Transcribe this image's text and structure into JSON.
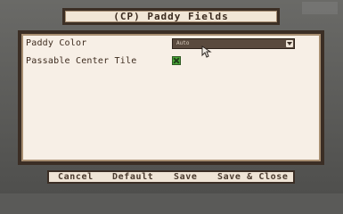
{
  "dialog": {
    "title": "(CP) Paddy Fields"
  },
  "options": [
    {
      "label": "Paddy Color",
      "control": "dropdown",
      "value": "Auto"
    },
    {
      "label": "Passable Center Tile",
      "control": "checkbox",
      "checked": true
    }
  ],
  "buttons": {
    "cancel": "Cancel",
    "default": "Default",
    "save": "Save",
    "save_close": "Save & Close"
  },
  "icons": {
    "dropdown_arrow": "chevron-down-icon",
    "cursor": "hand-pointer-icon"
  },
  "colors": {
    "panel_bg": "#f7efe6",
    "panel_border": "#3b2e25",
    "checkbox_checked": "#4aa83a"
  }
}
